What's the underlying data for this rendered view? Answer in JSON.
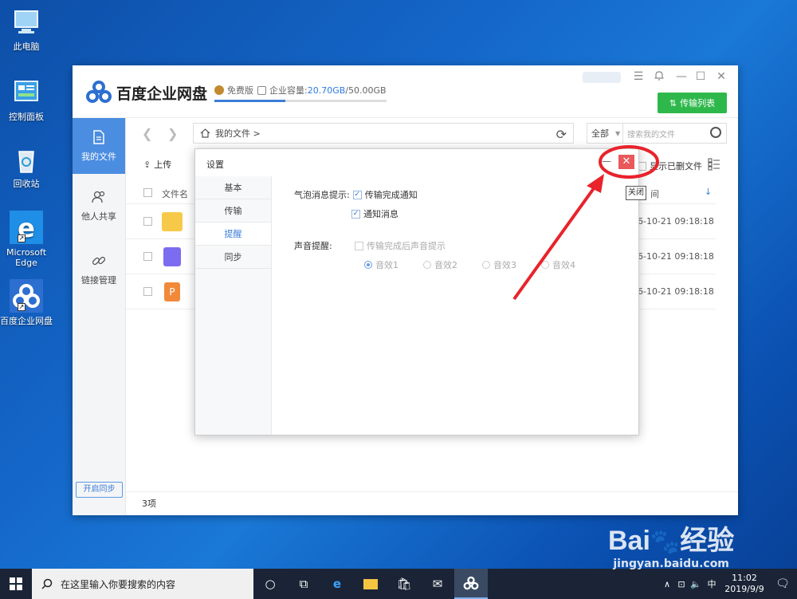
{
  "desktop": {
    "icons": [
      {
        "label": "此电脑"
      },
      {
        "label": "控制面板"
      },
      {
        "label": "回收站"
      },
      {
        "label": "Microsoft Edge"
      },
      {
        "label": "百度企业网盘"
      }
    ]
  },
  "app": {
    "title": "百度企业网盘",
    "plan": "免费版",
    "capacity_label": "企业容量:",
    "capacity_used": "20.70GB",
    "capacity_total": "/50.00GB",
    "capacity_fraction": 0.414,
    "transfer_button": "传输列表",
    "sidebar": [
      {
        "label": "我的文件",
        "icon": "document-icon"
      },
      {
        "label": "他人共享",
        "icon": "users-icon"
      },
      {
        "label": "链接管理",
        "icon": "link-icon"
      }
    ],
    "sync_button": "开启同步",
    "path": "我的文件 >",
    "filter": "全部",
    "search_placeholder": "搜索我的文件",
    "upload": "上传",
    "show_deleted": "显示已删文件",
    "column_name": "文件名",
    "column_time": "间",
    "rows": [
      {
        "type": "folder",
        "time": "6-10-21 09:18:18"
      },
      {
        "type": "video",
        "time": "6-10-21 09:18:18"
      },
      {
        "type": "ppt",
        "time": "6-10-21 09:18:18"
      }
    ],
    "count": "3项"
  },
  "settings": {
    "title": "设置",
    "tabs": [
      "基本",
      "传输",
      "提醒",
      "同步"
    ],
    "active_tab": "提醒",
    "bubble_label": "气泡消息提示:",
    "bubble_opt1": "传输完成通知",
    "bubble_opt2": "通知消息",
    "sound_label": "声音提醒:",
    "sound_opt": "传输完成后声音提示",
    "effects": [
      "音效1",
      "音效2",
      "音效3",
      "音效4"
    ],
    "close_tooltip": "关闭"
  },
  "taskbar": {
    "search_placeholder": "在这里输入你要搜索的内容",
    "ime": "中",
    "time": "11:02",
    "date": "2019/9/9"
  },
  "watermark": {
    "brand": "Bai",
    "brand2": "经验",
    "url": "jingyan.baidu.com"
  },
  "colors": {
    "accent": "#3b7dd8",
    "green": "#2eb84b",
    "close_red": "#e9585b",
    "annotation": "#e8232b"
  }
}
